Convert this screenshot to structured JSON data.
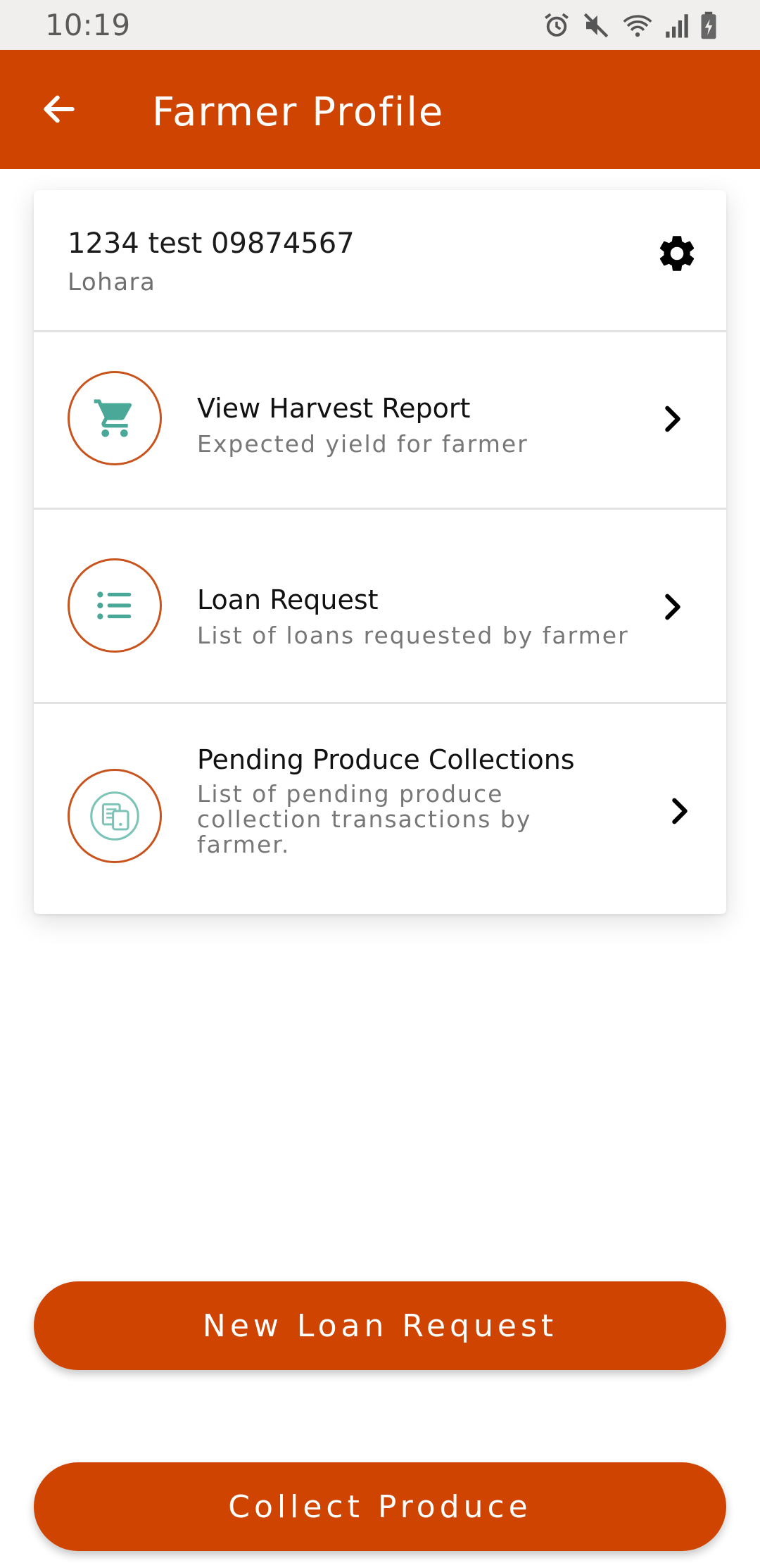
{
  "status_bar": {
    "time": "10:19",
    "icons": [
      "alarm-icon",
      "mute-icon",
      "wifi-icon",
      "signal-icon",
      "battery-icon"
    ]
  },
  "app_bar": {
    "title": "Farmer Profile",
    "back_icon": "arrow-left-icon"
  },
  "farmer": {
    "name": "1234 test 09874567",
    "location": "Lohara",
    "settings_icon": "gear-icon"
  },
  "menu": {
    "items": [
      {
        "title": "View Harvest Report",
        "subtitle": "Expected yield for farmer",
        "icon": "cart-icon"
      },
      {
        "title": "Loan Request",
        "subtitle": "List of loans requested by farmer",
        "icon": "list-icon"
      },
      {
        "title": "Pending Produce Collections",
        "subtitle": "List of pending produce collection transactions by farmer.",
        "icon": "receipt-icon"
      }
    ]
  },
  "actions": {
    "new_loan_label": "New Loan Request",
    "collect_label": "Collect Produce"
  },
  "colors": {
    "primary": "#cf4400",
    "icon_teal": "#4aa899",
    "icon_ring": "#c9531d"
  }
}
